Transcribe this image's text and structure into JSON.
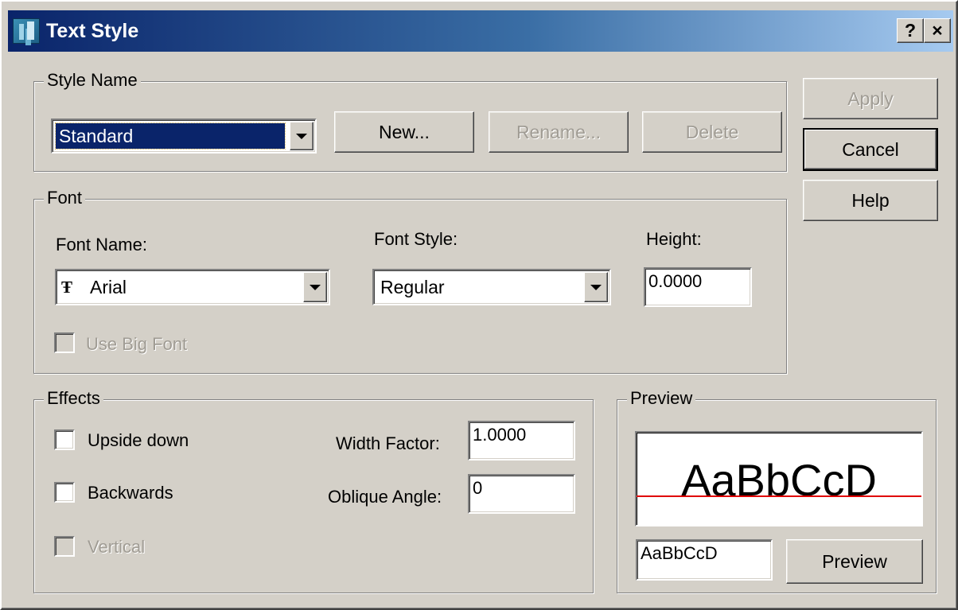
{
  "window": {
    "title": "Text Style",
    "help_button": "?",
    "close_button": "×"
  },
  "style_name": {
    "group_label": "Style Name",
    "selected": "Standard",
    "new_button": "New...",
    "rename_button": "Rename...",
    "delete_button": "Delete"
  },
  "side_buttons": {
    "apply": "Apply",
    "cancel": "Cancel",
    "help": "Help"
  },
  "font": {
    "group_label": "Font",
    "font_name_label": "Font Name:",
    "font_name_value": "Arial",
    "font_name_icon": "Ŧ",
    "font_style_label": "Font Style:",
    "font_style_value": "Regular",
    "height_label": "Height:",
    "height_value": "0.0000",
    "use_big_font_label": "Use Big Font",
    "use_big_font_checked": false
  },
  "effects": {
    "group_label": "Effects",
    "upside_down_label": "Upside down",
    "upside_down_checked": false,
    "backwards_label": "Backwards",
    "backwards_checked": false,
    "vertical_label": "Vertical",
    "vertical_checked": false,
    "width_factor_label": "Width Factor:",
    "width_factor_value": "1.0000",
    "oblique_angle_label": "Oblique Angle:",
    "oblique_angle_value": "0"
  },
  "preview": {
    "group_label": "Preview",
    "sample_text": "AaBbCcD",
    "input_value": "AaBbCcD",
    "preview_button": "Preview",
    "baseline_color": "#e00000"
  },
  "colors": {
    "dialog_face": "#d4d0c8",
    "title_start": "#0a246a",
    "title_end": "#a6caf0",
    "selection": "#0a246a"
  }
}
